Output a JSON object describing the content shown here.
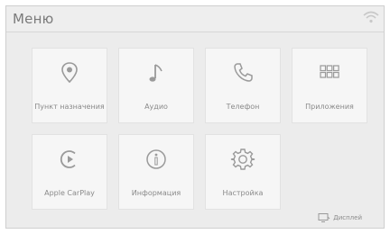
{
  "header": {
    "title": "Меню"
  },
  "menu": {
    "items": [
      {
        "label": "Пункт назначения",
        "icon": "map-pin-icon"
      },
      {
        "label": "Аудио",
        "icon": "music-note-icon"
      },
      {
        "label": "Телефон",
        "icon": "phone-icon"
      },
      {
        "label": "Приложения",
        "icon": "apps-grid-icon"
      },
      {
        "label": "Apple CarPlay",
        "icon": "carplay-icon"
      },
      {
        "label": "Информация",
        "icon": "info-icon"
      },
      {
        "label": "Настройка",
        "icon": "gear-icon"
      }
    ]
  },
  "footer": {
    "display_label": "Дисплей"
  },
  "colors": {
    "background": "#ececec",
    "tile": "#f6f6f6",
    "icon": "#9a9a9a",
    "text": "#8a8a8a"
  }
}
